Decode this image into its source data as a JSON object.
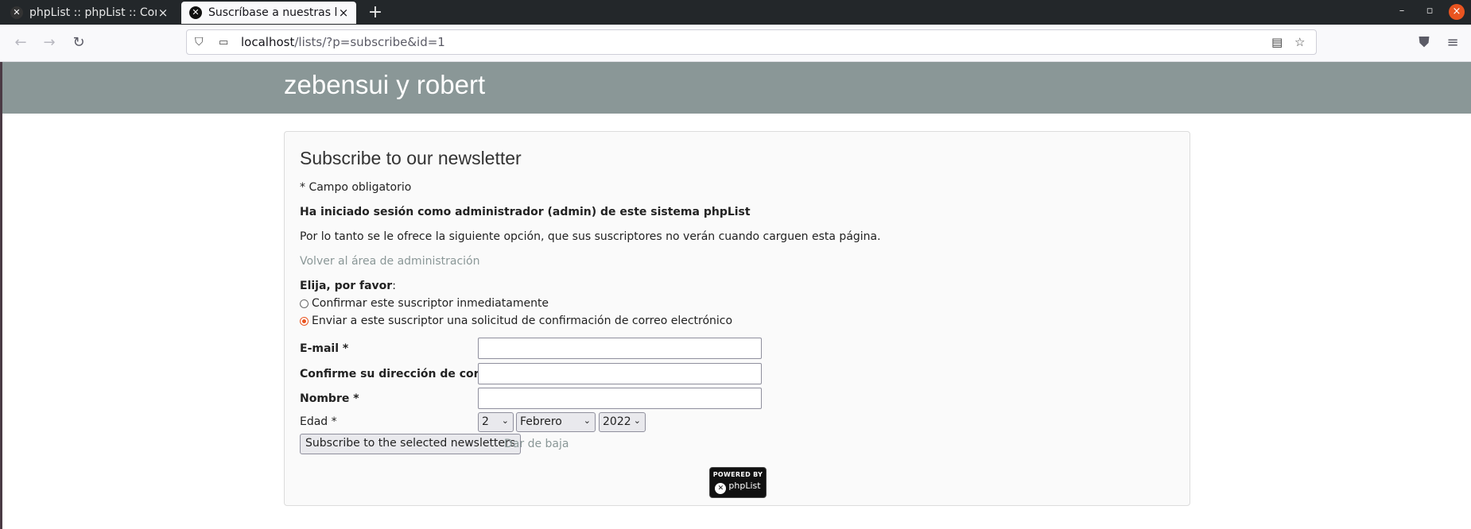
{
  "browser": {
    "tabs": [
      {
        "title": "phpList :: phpList :: Confi",
        "active": false
      },
      {
        "title": "Suscríbase a nuestras listas",
        "active": true
      }
    ],
    "new_tab": "+",
    "url_host": "localhost",
    "url_path": "/lists/?p=subscribe&id=1"
  },
  "page": {
    "site_title": "zebensui y robert",
    "heading": "Subscribe to our newsletter",
    "required_note": "* Campo obligatorio",
    "admin_notice": "Ha iniciado sesión como administrador (admin) de este sistema phpList",
    "admin_info": "Por lo tanto se le ofrece la siguiente opción, que sus suscriptores no verán cuando carguen esta página.",
    "back_link": "Volver al área de administración",
    "choose_label": "Elija, por favor",
    "choose_colon": ":",
    "options": [
      {
        "label": "Confirmar este suscriptor inmediatamente",
        "checked": false
      },
      {
        "label": "Enviar a este suscriptor una solicitud de confirmación de correo electrónico",
        "checked": true
      }
    ],
    "fields": {
      "email_label": "E-mail *",
      "email_value": "",
      "confirm_label": "Confirme su dirección de correo *",
      "confirm_value": "",
      "name_label": "Nombre *",
      "name_value": "",
      "age_label": "Edad *",
      "age_day": "2",
      "age_month": "Febrero",
      "age_year": "2022"
    },
    "submit_label": "Subscribe to the selected newsletters",
    "unsubscribe_link": "Dar de baja",
    "powered_by": "POWERED BY",
    "powered_brand": "phpList"
  },
  "colors": {
    "header_bg": "#8a9797",
    "radio_accent": "#e95420",
    "link": "#8a9797"
  }
}
